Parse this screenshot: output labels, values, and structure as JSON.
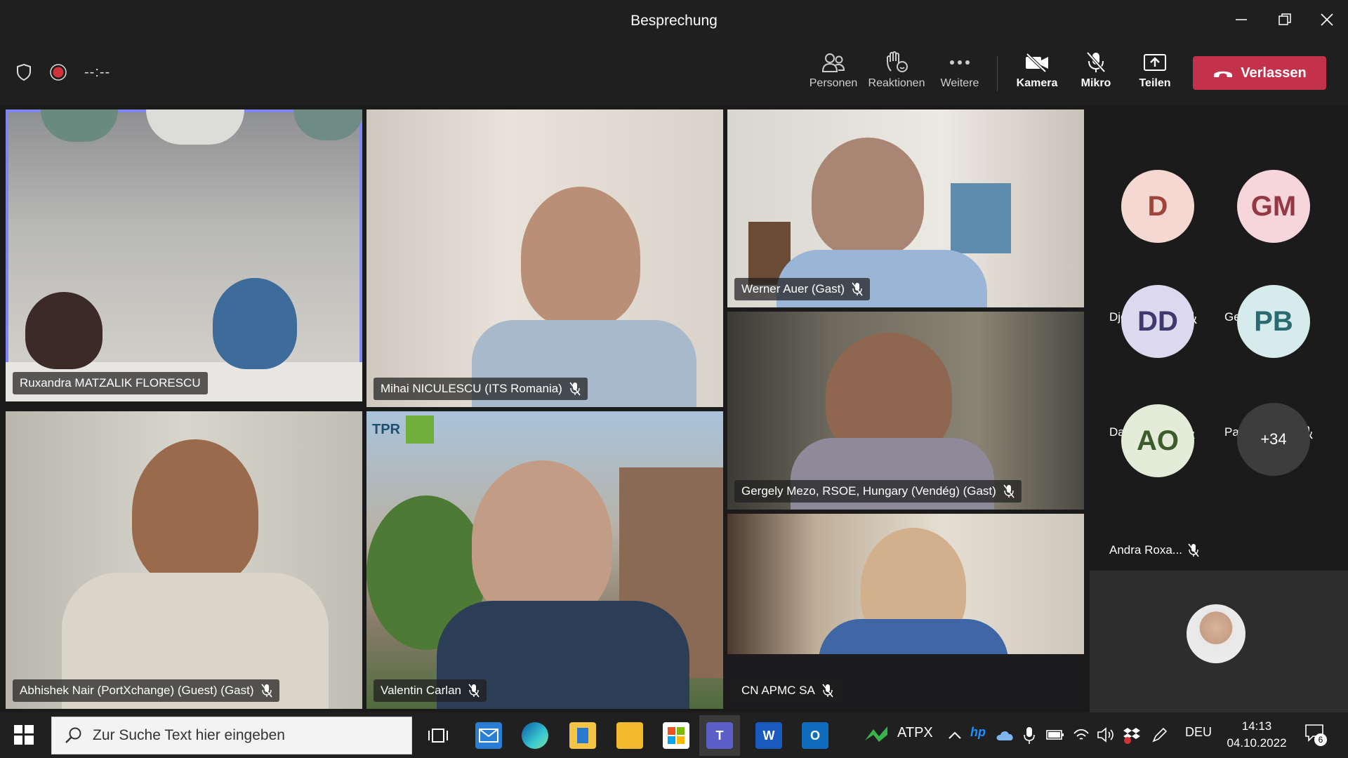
{
  "window": {
    "title": "Besprechung"
  },
  "toolbar": {
    "timer": "--:--",
    "buttons": [
      {
        "label": "Personen"
      },
      {
        "label": "Reaktionen"
      },
      {
        "label": "Weitere"
      },
      {
        "label": "Kamera"
      },
      {
        "label": "Mikro"
      },
      {
        "label": "Teilen"
      }
    ],
    "leave_label": "Verlassen"
  },
  "tiles": [
    {
      "name": "Ruxandra MATZALIK FLORESCU",
      "muted": false,
      "active": true
    },
    {
      "name": "Mihai NICULESCU (ITS Romania)",
      "muted": true
    },
    {
      "name": "Werner Auer (Gast)",
      "muted": true
    },
    {
      "name": "Gergely Mezo, RSOE, Hungary (Vendég) (Gast)",
      "muted": true
    },
    {
      "name": "Abhishek Nair (PortXchange) (Guest) (Gast)",
      "muted": true
    },
    {
      "name": "Valentin Carlan",
      "muted": true
    },
    {
      "name": "CN APMC SA",
      "muted": true
    }
  ],
  "tile_overlay": {
    "logo_text": "TPR"
  },
  "participants": [
    {
      "initials": "D",
      "name": "Djordje (Gu...",
      "bg": "#f6d8d3",
      "fg": "#a0453a"
    },
    {
      "initials": "GM",
      "name": "Georgiana ...",
      "bg": "#f7d6db",
      "fg": "#933945"
    },
    {
      "initials": "DD",
      "name": "Dan Dolghi...",
      "bg": "#dcd8ee",
      "fg": "#3e3a6e"
    },
    {
      "initials": "PB",
      "name": "Patricia Brü...",
      "bg": "#d6ecec",
      "fg": "#2b6a70"
    },
    {
      "initials": "AO",
      "name": "Andra Roxa...",
      "bg": "#e3ecd8",
      "fg": "#3e5b2c"
    }
  ],
  "overflow_count": "+34",
  "taskbar": {
    "search_placeholder": "Zur Suche Text hier eingeben",
    "tray_app": "ATPX",
    "language": "DEU",
    "time": "14:13",
    "date": "04.10.2022",
    "notifications": "6"
  },
  "colors": {
    "leave": "#c4314b",
    "active_border": "#7f85f5"
  }
}
